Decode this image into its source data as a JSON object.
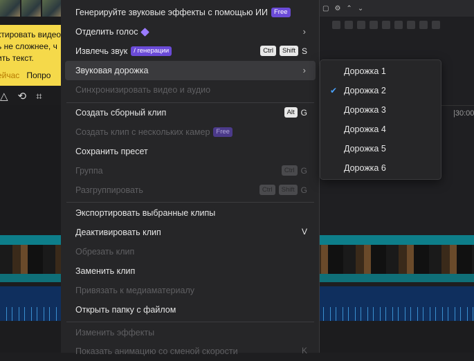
{
  "background": {
    "promo_lines": [
      "ктировать видео",
      "ь не сложнее, ч",
      "ить текст."
    ],
    "promo_link_try": "ейчас",
    "promo_link_more": "Попро",
    "timeline_time": "|30:00"
  },
  "menu": {
    "items": [
      {
        "label": "Генерируйте звуковые эффекты с помощью ИИ",
        "badge": "Free"
      },
      {
        "label": "Отделить голос"
      },
      {
        "label": "Извлечь звук",
        "badge": "/ генерации",
        "keys": [
          "Ctrl",
          "Shift"
        ],
        "key_letter": "S"
      },
      {
        "label": "Звуковая дорожка"
      },
      {
        "label": "Синхронизировать видео и аудио"
      },
      {
        "label": "Создать сборный клип",
        "keys": [
          "Alt"
        ],
        "key_letter": "G"
      },
      {
        "label": "Создать клип с нескольких камер",
        "badge": "Free"
      },
      {
        "label": "Сохранить пресет"
      },
      {
        "label": "Группа",
        "keys": [
          "Ctrl"
        ],
        "key_letter": "G"
      },
      {
        "label": "Разгруппировать",
        "keys": [
          "Ctrl",
          "Shift"
        ],
        "key_letter": "G"
      },
      {
        "label": "Экспортировать выбранные клипы"
      },
      {
        "label": "Деактивировать клип",
        "key_letter": "V"
      },
      {
        "label": "Обрезать клип"
      },
      {
        "label": "Заменить клип"
      },
      {
        "label": "Привязать к медиаматериалу"
      },
      {
        "label": "Открыть папку с файлом"
      },
      {
        "label": "Изменить эффекты"
      },
      {
        "label": "Показать анимацию со сменой скорости",
        "key_letter": "K"
      }
    ]
  },
  "submenu": {
    "items": [
      "Дорожка 1",
      "Дорожка 2",
      "Дорожка 3",
      "Дорожка 4",
      "Дорожка 5",
      "Дорожка 6"
    ],
    "checked": "Дорожка 2"
  },
  "colors": {
    "accent": "#4aa3ff",
    "badge": "#6b4bd8",
    "promo": "#f5d94a"
  }
}
